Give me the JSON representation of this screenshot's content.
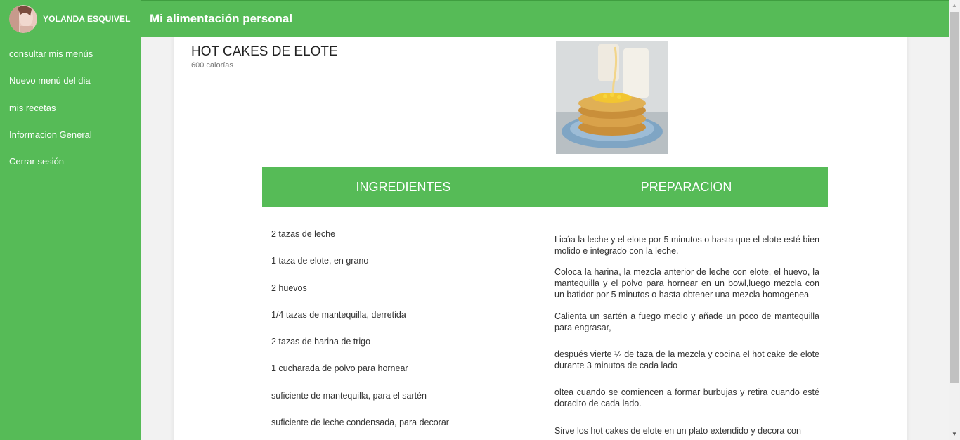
{
  "user": {
    "name": "YOLANDA ESQUIVEL"
  },
  "sidebar": {
    "items": [
      {
        "label": "consultar mis menús"
      },
      {
        "label": "Nuevo menú del dia"
      },
      {
        "label": "mis recetas"
      },
      {
        "label": "Informacion General"
      },
      {
        "label": "Cerrar sesión"
      }
    ]
  },
  "header": {
    "title": "Mi alimentación personal"
  },
  "recipe": {
    "title": "HOT CAKES DE ELOTE",
    "calories": "600 calorías",
    "ingredients_header": "INGREDIENTES",
    "preparation_header": "PREPARACION",
    "ingredients": [
      "2 tazas de leche",
      "1 taza de elote, en grano",
      "2 huevos",
      "1/4 tazas de mantequilla, derretida",
      "2 tazas de harina de trigo",
      "1 cucharada de polvo para hornear",
      "suficiente de mantequilla, para el sartén",
      "suficiente de leche condensada, para decorar"
    ],
    "steps": [
      "Licúa la leche y el elote por 5 minutos o hasta que el elote esté bien molido e integrado con la leche.",
      "Coloca la harina, la mezcla anterior de leche con elote, el huevo, la mantequilla y el polvo para hornear en un bowl,luego mezcla con un batidor por 5 minutos o hasta obtener una mezcla homogenea",
      "Calienta un sartén a fuego medio y añade un poco de mantequilla para engrasar,",
      "después vierte ¼ de taza de la mezcla y cocina el hot cake de elote durante 3 minutos de cada lado",
      "oltea cuando se comiencen a formar burbujas y retira cuando esté doradito de cada lado.",
      "Sirve los hot cakes de elote en un plato extendido y decora con"
    ]
  },
  "colors": {
    "brand_green": "#56bb57"
  }
}
